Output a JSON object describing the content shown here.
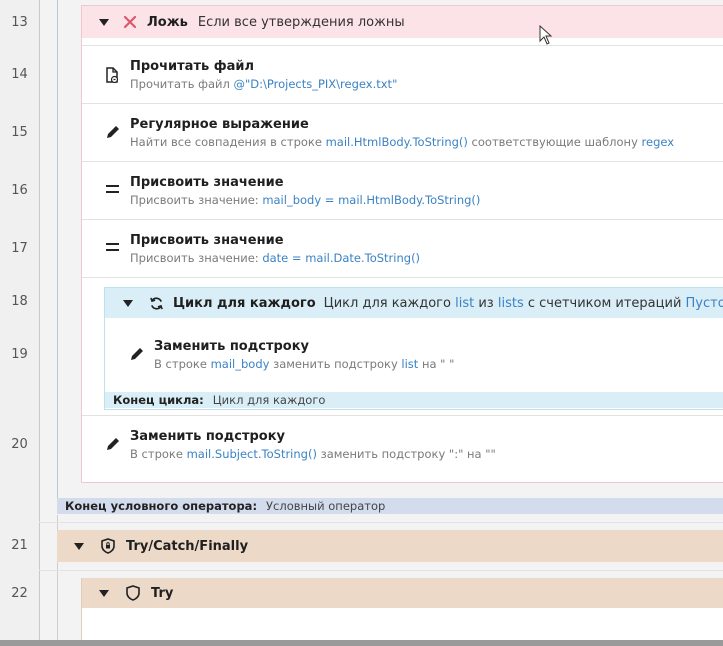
{
  "line_numbers": [
    "13",
    "14",
    "15",
    "16",
    "17",
    "18",
    "19",
    "20",
    "21",
    "22"
  ],
  "false_branch": {
    "label": "Ложь",
    "desc": "Если все утверждения ложны"
  },
  "read_file": {
    "title": "Прочитать файл",
    "prefix": "Прочитать файл ",
    "path": "@\"D:\\Projects_PIX\\regex.txt\""
  },
  "regex": {
    "title": "Регулярное выражение",
    "p1": "Найти все совпадения в строке ",
    "v1": "mail.HtmlBody.ToString()",
    "p2": " соответствующие шаблону ",
    "v2": "regex"
  },
  "assign1": {
    "title": "Присвоить значение",
    "p1": "Присвоить значение: ",
    "v1": "mail_body",
    "p2": " = ",
    "v2": "mail.HtmlBody.ToString()"
  },
  "assign2": {
    "title": "Присвоить значение",
    "p1": "Присвоить значение: ",
    "v1": "date",
    "p2": " = ",
    "v2": "mail.Date.ToString()"
  },
  "foreach": {
    "title": "Цикл для каждого",
    "p1": "Цикл для каждого ",
    "v1": "list",
    "p2": " из ",
    "v2": "lists",
    "p3": " с счетчиком итераций ",
    "v3": "Пусто"
  },
  "replace_inner": {
    "title": "Заменить подстроку",
    "p1": "В строке ",
    "v1": "mail_body",
    "p2": " заменить подстроку ",
    "v2": "list",
    "p3": " на \" \""
  },
  "loop_end": {
    "label": "Конец цикла:",
    "value": "Цикл для каждого"
  },
  "replace_outer": {
    "title": "Заменить подстроку",
    "p1": "В строке ",
    "v1": "mail.Subject.ToString()",
    "p2": " заменить подстроку \":\" на \"\""
  },
  "cond_end": {
    "label": "Конец условного оператора:",
    "value": "Условный оператор"
  },
  "try_catch": {
    "title": "Try/Catch/Finally"
  },
  "try": {
    "title": "Try"
  },
  "colors": {
    "false_header": "#fbe3e8",
    "loop_header": "#d9eef7",
    "cond_end": "#d3dcec",
    "try_header": "#ecd9c8",
    "link": "#3b82c4"
  }
}
